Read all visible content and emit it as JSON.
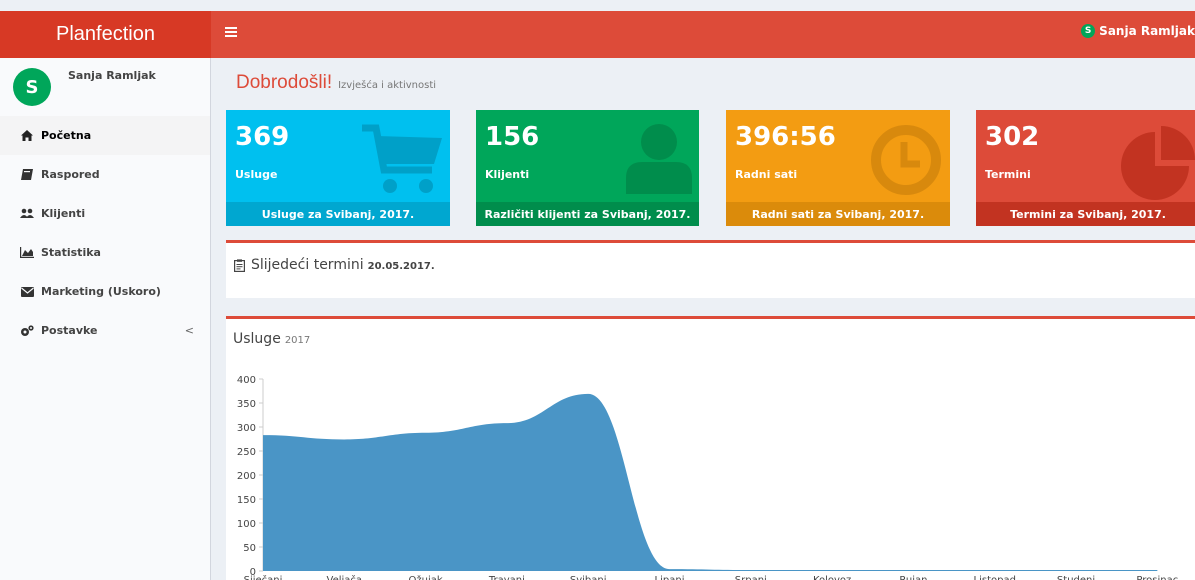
{
  "brand": "Planfection",
  "topbar": {
    "user_initial": "S",
    "user_name": "Sanja Ramljak"
  },
  "sidebar": {
    "user_initial": "S",
    "user_name": "Sanja Ramljak",
    "items": [
      {
        "label": "Početna",
        "icon": "home-icon"
      },
      {
        "label": "Raspored",
        "icon": "book-icon"
      },
      {
        "label": "Klijenti",
        "icon": "users-icon"
      },
      {
        "label": "Statistika",
        "icon": "area-chart-icon"
      },
      {
        "label": "Marketing (Uskoro)",
        "icon": "envelope-icon"
      },
      {
        "label": "Postavke",
        "icon": "cogs-icon",
        "chevron": "<"
      }
    ]
  },
  "header": {
    "title": "Dobrodošli!",
    "subtitle": "Izvješća i aktivnosti"
  },
  "stats": [
    {
      "value": "369",
      "label": "Usluge",
      "footer": "Usluge za Svibanj, 2017.",
      "icon": "cart-icon",
      "color": "#00c0ef"
    },
    {
      "value": "156",
      "label": "Klijenti",
      "footer": "Različiti klijenti za Svibanj, 2017.",
      "icon": "user-icon",
      "color": "#00a65a"
    },
    {
      "value": "396:56",
      "label": "Radni sati",
      "footer": "Radni sati za Svibanj, 2017.",
      "icon": "clock-icon",
      "color": "#f39c12"
    },
    {
      "value": "302",
      "label": "Termini",
      "footer": "Termini za Svibanj, 2017.",
      "icon": "pie-chart-icon",
      "color": "#dd4b39"
    }
  ],
  "upcoming": {
    "title": "Slijedeći termini",
    "date": "20.05.2017.",
    "icon": "clipboard-icon"
  },
  "services_panel": {
    "title": "Usluge",
    "year": "2017"
  },
  "chart_data": {
    "type": "area",
    "title": "",
    "xlabel": "",
    "ylabel": "",
    "categories": [
      "Siječanj",
      "Veljača",
      "Ožujak",
      "Travanj",
      "Svibanj",
      "Lipanj",
      "Srpanj",
      "Kolovoz",
      "Rujan",
      "Listopad",
      "Studeni",
      "Prosinac"
    ],
    "series": [
      {
        "values": [
          283,
          274,
          288,
          308,
          369,
          4,
          2,
          2,
          2,
          2,
          2,
          2
        ]
      }
    ],
    "ylim": [
      0,
      400
    ],
    "yticks": [
      0,
      50,
      100,
      150,
      200,
      250,
      300,
      350,
      400
    ],
    "grid": false,
    "color": "#4a95c6"
  }
}
